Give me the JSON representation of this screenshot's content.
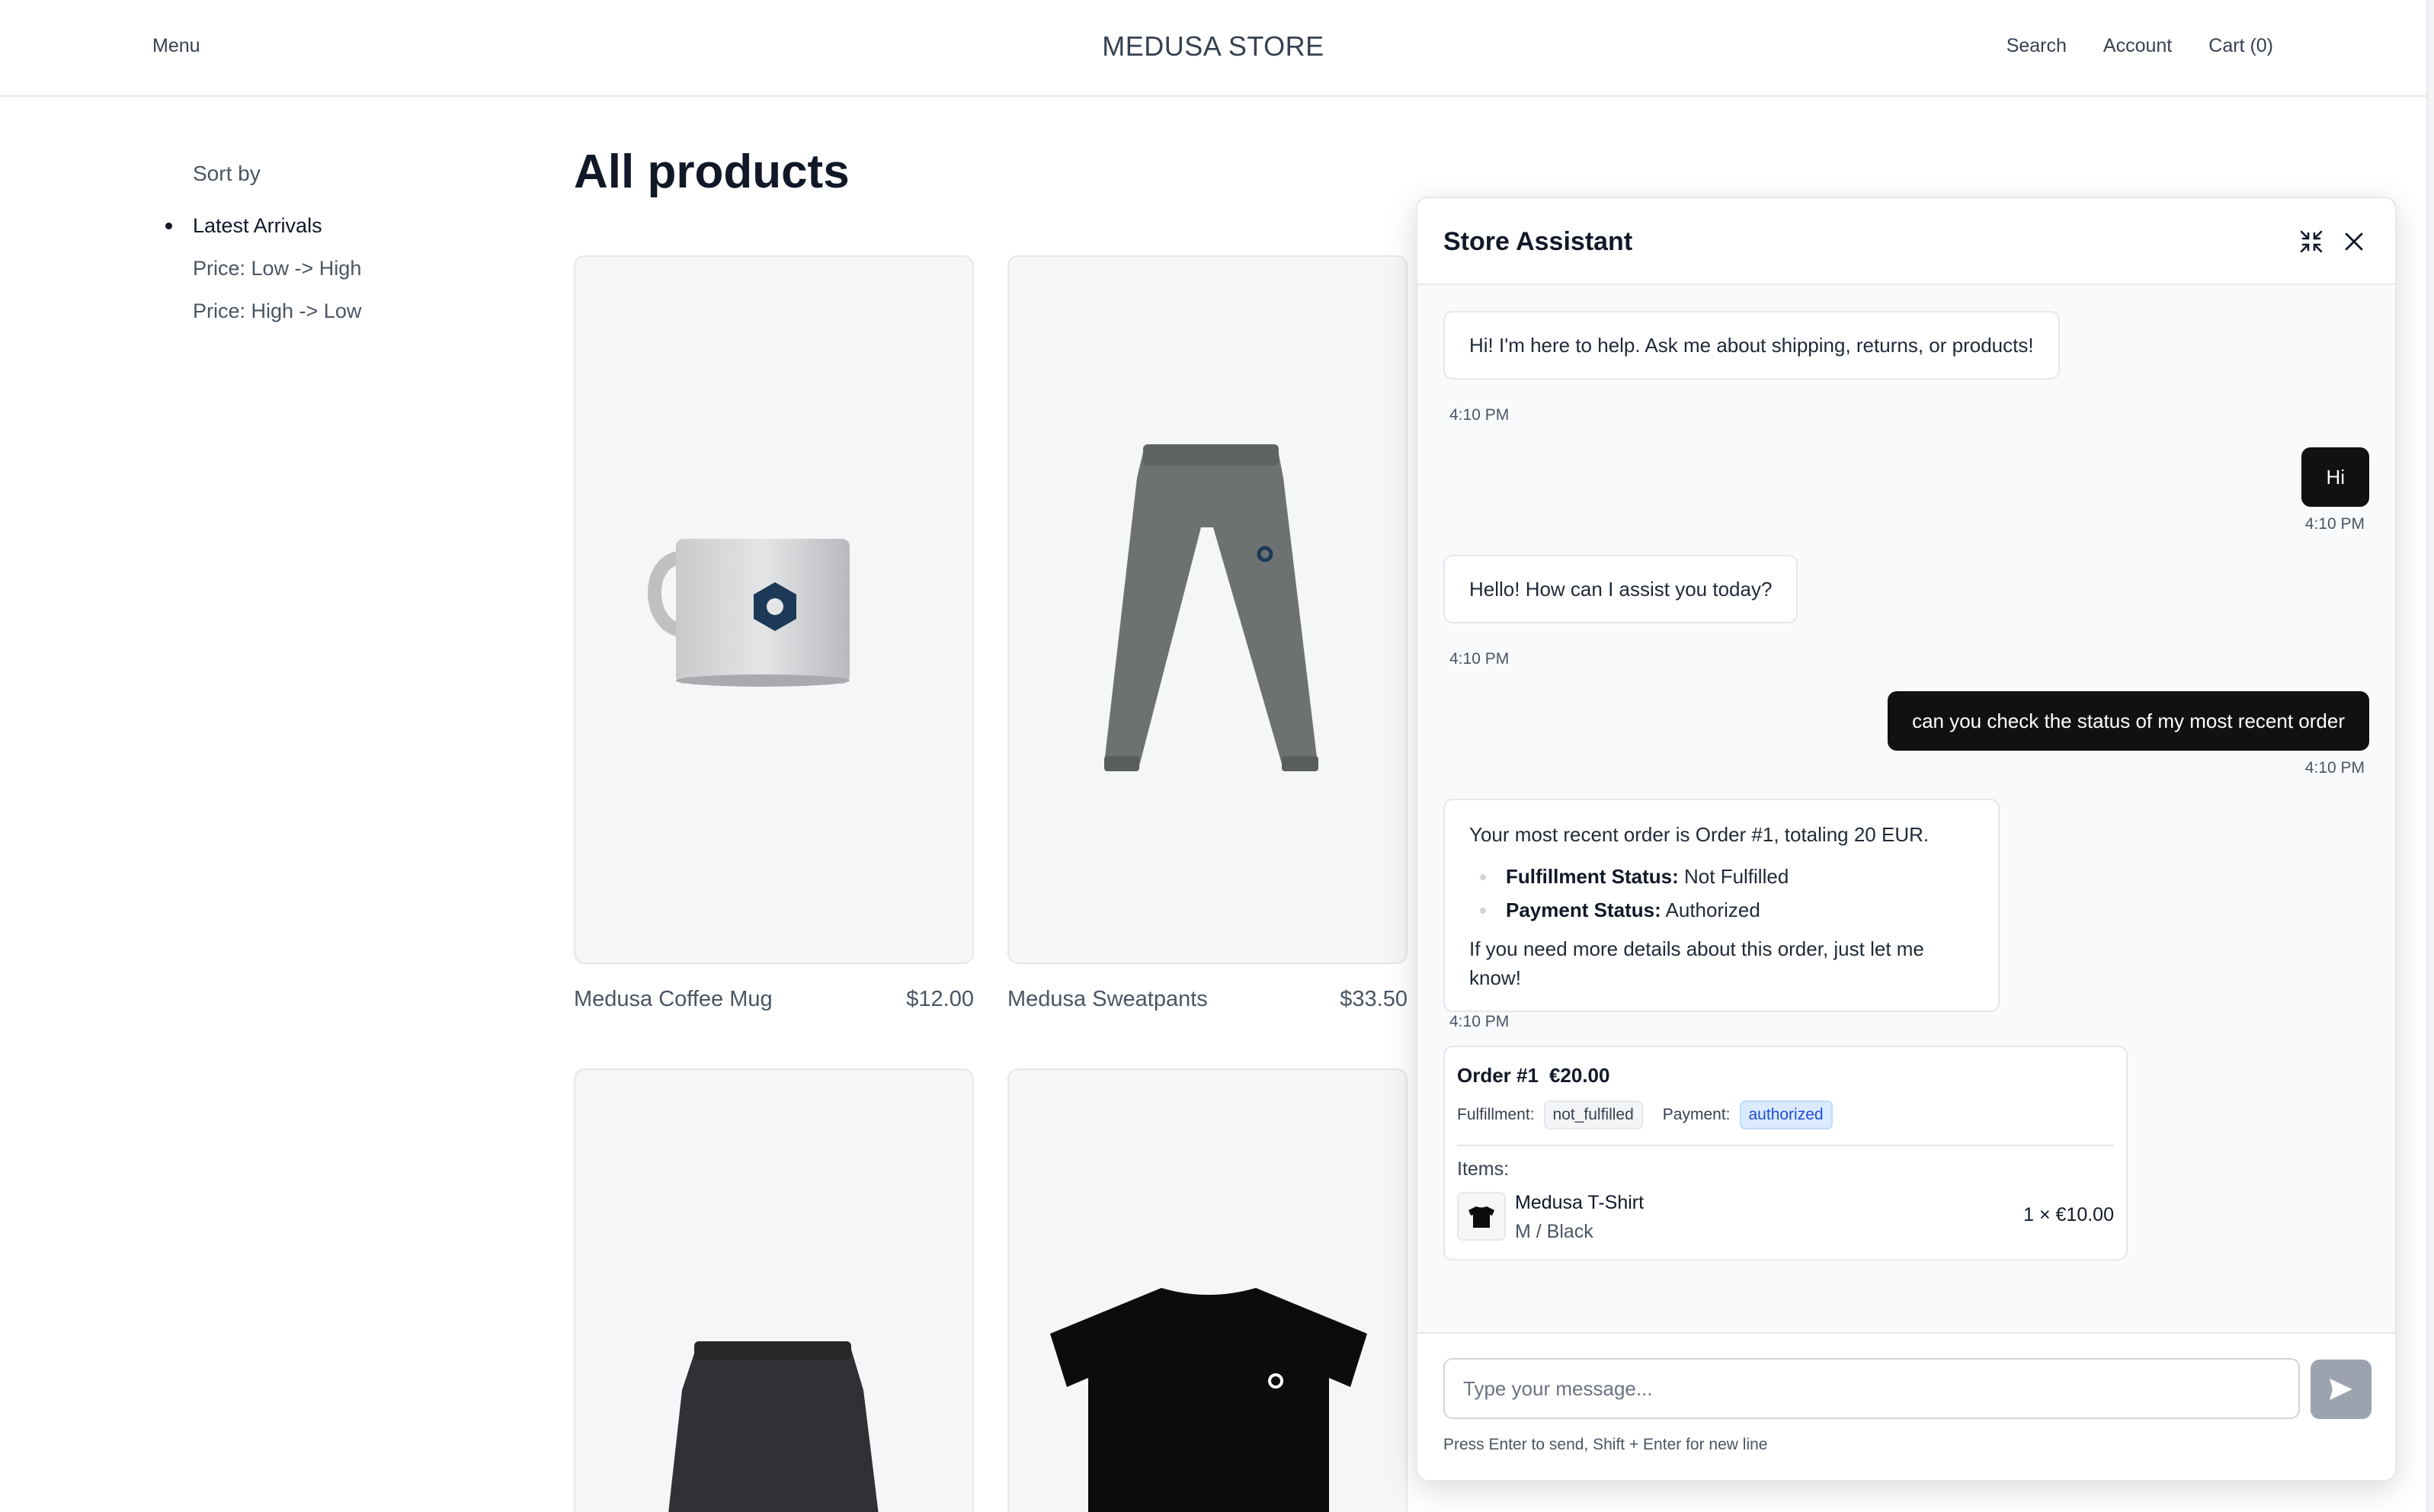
{
  "nav": {
    "menu": "Menu",
    "brand": "MEDUSA STORE",
    "search": "Search",
    "account": "Account",
    "cart": "Cart (0)"
  },
  "sidebar": {
    "sort_by": "Sort by",
    "options": [
      "Latest Arrivals",
      "Price: Low -> High",
      "Price: High -> Low"
    ],
    "selected": "Latest Arrivals"
  },
  "main": {
    "title": "All products",
    "products": [
      {
        "name": "Medusa Coffee Mug",
        "price": "$12.00",
        "image": "mug"
      },
      {
        "name": "Medusa Sweatpants",
        "price": "$33.50",
        "image": "sweatpants"
      },
      {
        "name": "",
        "price": "",
        "image": "shorts"
      },
      {
        "name": "",
        "price": "",
        "image": "t-shirt"
      }
    ]
  },
  "assistant": {
    "title": "Store Assistant",
    "messages": [
      {
        "role": "bot",
        "text": "Hi! I'm here to help. Ask me about shipping, returns, or products!",
        "time": "4:10 PM"
      },
      {
        "role": "user",
        "text": "Hi",
        "time": "4:10 PM"
      },
      {
        "role": "bot",
        "text": "Hello! How can I assist you today?",
        "time": "4:10 PM"
      },
      {
        "role": "user",
        "text": "can you check the status of my most recent order",
        "time": "4:10 PM"
      },
      {
        "role": "bot",
        "intro": "Your most recent order is Order #1, totaling 20 EUR.",
        "fulfillment_label": "Fulfillment Status:",
        "fulfillment_value": " Not Fulfilled",
        "payment_label": "Payment Status:",
        "payment_value": " Authorized",
        "outro": "If you need more details about this order, just let me know!",
        "time": "4:10 PM"
      }
    ],
    "order_card": {
      "order": "Order #1",
      "total": "€20.00",
      "fulfillment_label": "Fulfillment:",
      "fulfillment_value": "not_fulfilled",
      "payment_label": "Payment:",
      "payment_value": "authorized",
      "items_label": "Items:",
      "items": [
        {
          "name": "Medusa T-Shirt",
          "variant": "M / Black",
          "qty_price": "1 × €10.00"
        }
      ]
    },
    "input_placeholder": "Type your message...",
    "hint": "Press Enter to send, Shift + Enter for new line"
  },
  "colors": {
    "accent_dark": "#111111",
    "status_blue": "#1d4ed8",
    "send_button": "#9ca3af"
  }
}
